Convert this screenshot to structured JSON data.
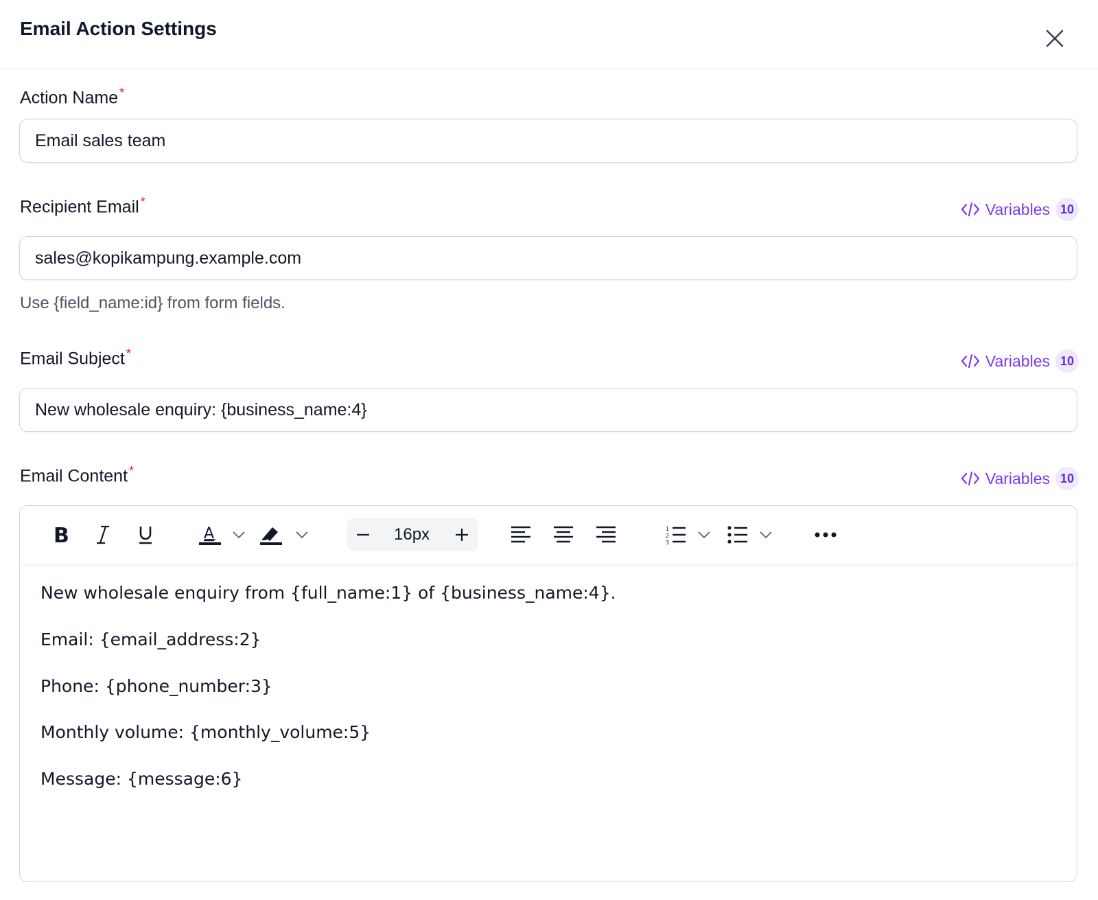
{
  "dialog": {
    "title": "Email Action Settings"
  },
  "fields": {
    "action_name": {
      "label": "Action Name",
      "required_mark": "*",
      "value": "Email sales team"
    },
    "recipient_email": {
      "label": "Recipient Email",
      "required_mark": "*",
      "value": "sales@kopikampung.example.com",
      "help": "Use {field_name:id} from form fields.",
      "variables_label": "Variables",
      "variables_count": "10"
    },
    "email_subject": {
      "label": "Email Subject",
      "required_mark": "*",
      "value": "New wholesale enquiry: {business_name:4}",
      "variables_label": "Variables",
      "variables_count": "10"
    },
    "email_content": {
      "label": "Email Content",
      "required_mark": "*",
      "variables_label": "Variables",
      "variables_count": "10",
      "toolbar": {
        "font_size": "16px",
        "buttons": [
          "bold-icon",
          "italic-icon",
          "underline-icon",
          "text-color-icon",
          "highlight-icon",
          "minus-icon",
          "plus-icon",
          "align-left-icon",
          "align-center-icon",
          "align-right-icon",
          "numbered-list-icon",
          "bullet-list-icon",
          "more-icon"
        ]
      },
      "paragraphs": [
        "New wholesale enquiry from {full_name:1} of {business_name:4}.",
        "Email: {email_address:2}",
        "Phone: {phone_number:3}",
        "Monthly volume: {monthly_volume:5}",
        "Message: {message:6}"
      ]
    }
  },
  "colors": {
    "accent": "#7c3aed",
    "badge_bg": "#ede9fe",
    "required": "#dc2626",
    "border": "#d1d5db"
  }
}
